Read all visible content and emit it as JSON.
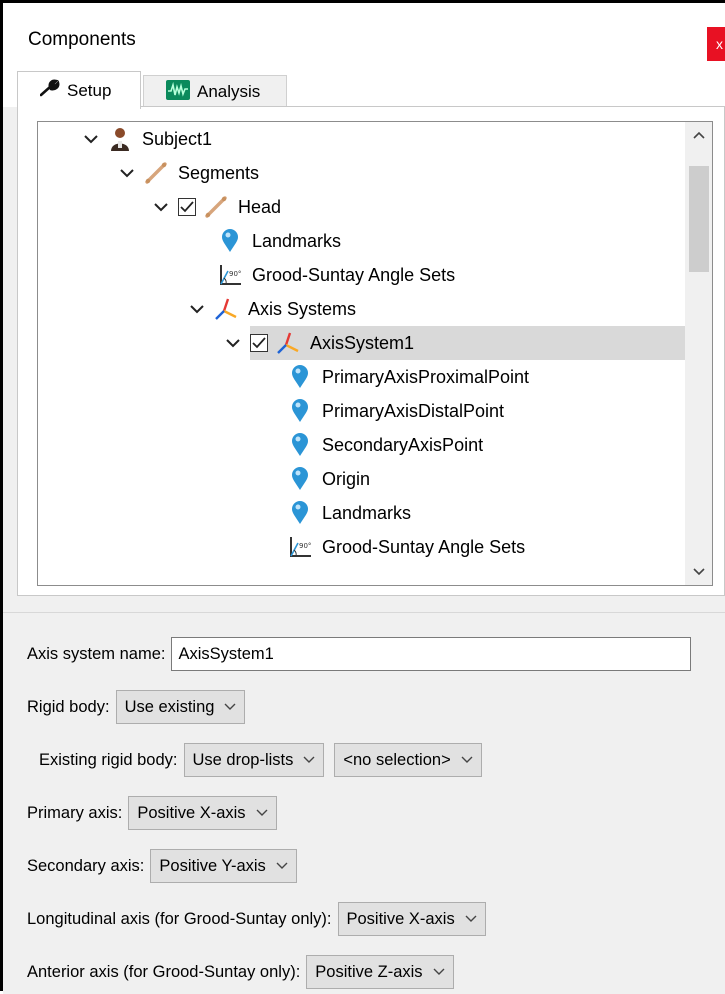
{
  "window": {
    "title": "Components",
    "close_label": "x"
  },
  "tabs": [
    {
      "label": "Setup",
      "icon": "wrench-icon",
      "active": true
    },
    {
      "label": "Analysis",
      "icon": "waveform-icon",
      "active": false
    }
  ],
  "tree": {
    "rows": [
      {
        "label": "Subject1",
        "icon": "person-icon",
        "expanded": true
      },
      {
        "label": "Segments",
        "icon": "bone-icon",
        "expanded": true
      },
      {
        "label": "Head",
        "icon": "bone-icon",
        "expanded": true,
        "checked": true
      },
      {
        "label": "Landmarks",
        "icon": "pin-icon"
      },
      {
        "label": "Grood-Suntay Angle Sets",
        "icon": "angle-icon"
      },
      {
        "label": "Axis Systems",
        "icon": "axes-icon",
        "expanded": true
      },
      {
        "label": "AxisSystem1",
        "icon": "axes-icon",
        "expanded": true,
        "checked": true,
        "selected": true
      },
      {
        "label": "PrimaryAxisProximalPoint",
        "icon": "pin-icon"
      },
      {
        "label": "PrimaryAxisDistalPoint",
        "icon": "pin-icon"
      },
      {
        "label": "SecondaryAxisPoint",
        "icon": "pin-icon"
      },
      {
        "label": "Origin",
        "icon": "pin-icon"
      },
      {
        "label": "Landmarks",
        "icon": "pin-icon"
      },
      {
        "label": "Grood-Suntay Angle Sets",
        "icon": "angle-icon"
      }
    ]
  },
  "form": {
    "axis_system_name_label": "Axis system name:",
    "axis_system_name_value": "AxisSystem1",
    "rigid_body_label": "Rigid body:",
    "rigid_body_value": "Use existing",
    "existing_rigid_body_label": "Existing rigid body:",
    "existing_rigid_body_value": "Use drop-lists",
    "existing_rigid_body_selection": "<no selection>",
    "primary_axis_label": "Primary axis:",
    "primary_axis_value": "Positive X-axis",
    "secondary_axis_label": "Secondary axis:",
    "secondary_axis_value": "Positive Y-axis",
    "longitudinal_axis_label": "Longitudinal axis (for Grood-Suntay only):",
    "longitudinal_axis_value": "Positive X-axis",
    "anterior_axis_label": "Anterior axis (for Grood-Suntay only):",
    "anterior_axis_value": "Positive Z-axis"
  }
}
